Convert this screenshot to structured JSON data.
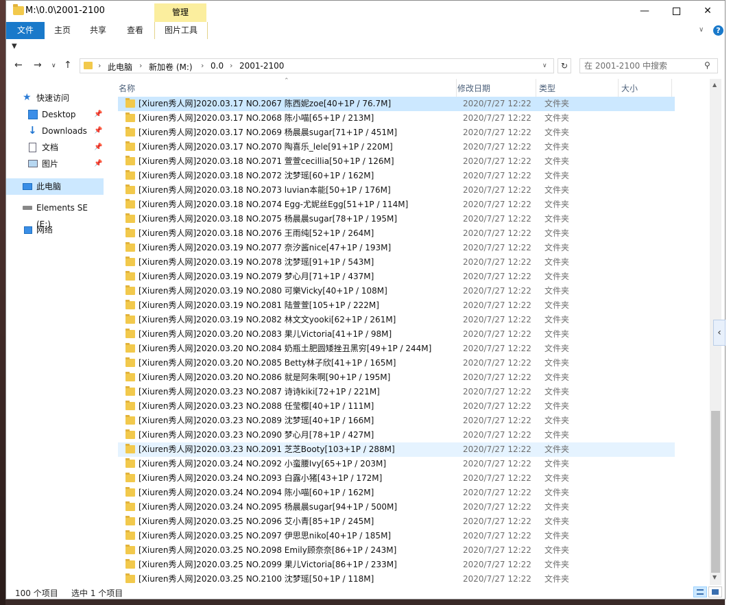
{
  "window": {
    "title": "M:\\0.0\\2001-2100",
    "context_tab": "管理"
  },
  "ribbon": {
    "tabs": [
      "文件",
      "主页",
      "共享",
      "查看",
      "图片工具"
    ]
  },
  "address": {
    "crumbs": [
      "此电脑",
      "新加卷 (M:)",
      "0.0",
      "2001-2100"
    ],
    "search_placeholder": "在 2001-2100 中搜索"
  },
  "sidebar": {
    "items": [
      {
        "label": "快速访问",
        "icon": "star-icon"
      },
      {
        "label": "Desktop",
        "icon": "desktop-icon"
      },
      {
        "label": "Downloads",
        "icon": "download-icon"
      },
      {
        "label": "文档",
        "icon": "document-icon"
      },
      {
        "label": "图片",
        "icon": "pictures-icon"
      },
      {
        "label": "此电脑",
        "icon": "computer-icon"
      },
      {
        "label": "Elements SE (E:)",
        "icon": "drive-icon"
      },
      {
        "label": "网络",
        "icon": "network-icon"
      }
    ]
  },
  "columns": {
    "name": "名称",
    "date": "修改日期",
    "type": "类型",
    "size": "大小"
  },
  "files": [
    {
      "name": "[Xiuren秀人网]2020.03.17 NO.2067 陈西妮zoe[40+1P / 76.7M]",
      "date": "2020/7/27 12:22",
      "type": "文件夹"
    },
    {
      "name": "[Xiuren秀人网]2020.03.17 NO.2068 陈小喵[65+1P / 213M]",
      "date": "2020/7/27 12:22",
      "type": "文件夹"
    },
    {
      "name": "[Xiuren秀人网]2020.03.17 NO.2069 杨晨晨sugar[71+1P / 451M]",
      "date": "2020/7/27 12:22",
      "type": "文件夹"
    },
    {
      "name": "[Xiuren秀人网]2020.03.17 NO.2070 陶喜乐_lele[91+1P / 220M]",
      "date": "2020/7/27 12:22",
      "type": "文件夹"
    },
    {
      "name": "[Xiuren秀人网]2020.03.18 NO.2071 萱萱cecillia[50+1P / 126M]",
      "date": "2020/7/27 12:22",
      "type": "文件夹"
    },
    {
      "name": "[Xiuren秀人网]2020.03.18 NO.2072 沈梦瑶[60+1P / 162M]",
      "date": "2020/7/27 12:22",
      "type": "文件夹"
    },
    {
      "name": "[Xiuren秀人网]2020.03.18 NO.2073 luvian本能[50+1P / 176M]",
      "date": "2020/7/27 12:22",
      "type": "文件夹"
    },
    {
      "name": "[Xiuren秀人网]2020.03.18 NO.2074 Egg-尤妮丝Egg[51+1P / 114M]",
      "date": "2020/7/27 12:22",
      "type": "文件夹"
    },
    {
      "name": "[Xiuren秀人网]2020.03.18 NO.2075 杨晨晨sugar[78+1P / 195M]",
      "date": "2020/7/27 12:22",
      "type": "文件夹"
    },
    {
      "name": "[Xiuren秀人网]2020.03.18 NO.2076 王雨纯[52+1P / 264M]",
      "date": "2020/7/27 12:22",
      "type": "文件夹"
    },
    {
      "name": "[Xiuren秀人网]2020.03.19 NO.2077 奈汐酱nice[47+1P / 193M]",
      "date": "2020/7/27 12:22",
      "type": "文件夹"
    },
    {
      "name": "[Xiuren秀人网]2020.03.19 NO.2078 沈梦瑶[91+1P / 543M]",
      "date": "2020/7/27 12:22",
      "type": "文件夹"
    },
    {
      "name": "[Xiuren秀人网]2020.03.19 NO.2079 梦心月[71+1P / 437M]",
      "date": "2020/7/27 12:22",
      "type": "文件夹"
    },
    {
      "name": "[Xiuren秀人网]2020.03.19 NO.2080 可樂Vicky[40+1P / 108M]",
      "date": "2020/7/27 12:22",
      "type": "文件夹"
    },
    {
      "name": "[Xiuren秀人网]2020.03.19 NO.2081 陆萱萱[105+1P / 222M]",
      "date": "2020/7/27 12:22",
      "type": "文件夹"
    },
    {
      "name": "[Xiuren秀人网]2020.03.19 NO.2082 林文文yooki[62+1P / 261M]",
      "date": "2020/7/27 12:22",
      "type": "文件夹"
    },
    {
      "name": "[Xiuren秀人网]2020.03.20 NO.2083 果儿Victoria[41+1P / 98M]",
      "date": "2020/7/27 12:22",
      "type": "文件夹"
    },
    {
      "name": "[Xiuren秀人网]2020.03.20 NO.2084 奶瓶土肥圆矮挫丑黑穷[49+1P / 244M]",
      "date": "2020/7/27 12:22",
      "type": "文件夹"
    },
    {
      "name": "[Xiuren秀人网]2020.03.20 NO.2085 Betty林子欣[41+1P / 165M]",
      "date": "2020/7/27 12:22",
      "type": "文件夹"
    },
    {
      "name": "[Xiuren秀人网]2020.03.20 NO.2086 就是阿朱啊[90+1P / 195M]",
      "date": "2020/7/27 12:22",
      "type": "文件夹"
    },
    {
      "name": "[Xiuren秀人网]2020.03.23 NO.2087 诗诗kiki[72+1P / 221M]",
      "date": "2020/7/27 12:22",
      "type": "文件夹"
    },
    {
      "name": "[Xiuren秀人网]2020.03.23 NO.2088 任莹樱[40+1P / 111M]",
      "date": "2020/7/27 12:22",
      "type": "文件夹"
    },
    {
      "name": "[Xiuren秀人网]2020.03.23 NO.2089 沈梦瑶[40+1P / 166M]",
      "date": "2020/7/27 12:22",
      "type": "文件夹"
    },
    {
      "name": "[Xiuren秀人网]2020.03.23 NO.2090 梦心月[78+1P / 427M]",
      "date": "2020/7/27 12:22",
      "type": "文件夹"
    },
    {
      "name": "[Xiuren秀人网]2020.03.23 NO.2091 芝芝Booty[103+1P / 288M]",
      "date": "2020/7/27 12:22",
      "type": "文件夹"
    },
    {
      "name": "[Xiuren秀人网]2020.03.24 NO.2092 小蛮腰Ivy[65+1P / 203M]",
      "date": "2020/7/27 12:22",
      "type": "文件夹"
    },
    {
      "name": "[Xiuren秀人网]2020.03.24 NO.2093 白露小猪[43+1P / 172M]",
      "date": "2020/7/27 12:22",
      "type": "文件夹"
    },
    {
      "name": "[Xiuren秀人网]2020.03.24 NO.2094 陈小喵[60+1P / 162M]",
      "date": "2020/7/27 12:22",
      "type": "文件夹"
    },
    {
      "name": "[Xiuren秀人网]2020.03.24 NO.2095 杨晨晨sugar[94+1P / 500M]",
      "date": "2020/7/27 12:22",
      "type": "文件夹"
    },
    {
      "name": "[Xiuren秀人网]2020.03.25 NO.2096 艾小青[85+1P / 245M]",
      "date": "2020/7/27 12:22",
      "type": "文件夹"
    },
    {
      "name": "[Xiuren秀人网]2020.03.25 NO.2097 伊思思niko[40+1P / 185M]",
      "date": "2020/7/27 12:22",
      "type": "文件夹"
    },
    {
      "name": "[Xiuren秀人网]2020.03.25 NO.2098 Emily顾奈奈[86+1P / 243M]",
      "date": "2020/7/27 12:22",
      "type": "文件夹"
    },
    {
      "name": "[Xiuren秀人网]2020.03.25 NO.2099 果儿Victoria[86+1P / 233M]",
      "date": "2020/7/27 12:22",
      "type": "文件夹"
    },
    {
      "name": "[Xiuren秀人网]2020.03.25 NO.2100 沈梦瑶[50+1P / 118M]",
      "date": "2020/7/27 12:22",
      "type": "文件夹"
    }
  ],
  "status": {
    "count": "100 个项目",
    "selected": "选中 1 个项目"
  },
  "colors": {
    "accent": "#1979ca",
    "selection": "#cce8ff",
    "context_tab": "#fbee9e",
    "folder": "#f2c94c"
  }
}
